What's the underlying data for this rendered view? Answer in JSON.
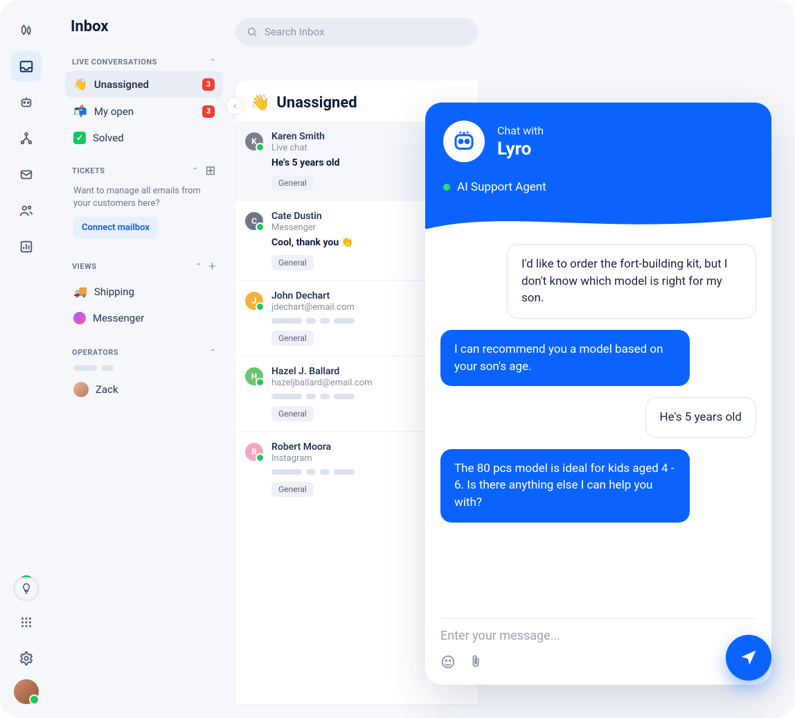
{
  "header": {
    "title": "Inbox",
    "search_placeholder": "Search Inbox"
  },
  "sections": {
    "live": {
      "title": "LIVE CONVERSATIONS",
      "items": [
        {
          "icon": "👋",
          "label": "Unassigned",
          "badge": "3"
        },
        {
          "icon": "📬",
          "label": "My open",
          "badge": "3"
        },
        {
          "icon": "✓",
          "label": "Solved"
        }
      ]
    },
    "tickets": {
      "title": "TICKETS",
      "note": "Want to manage all emails from your customers here?",
      "connect": "Connect mailbox"
    },
    "views": {
      "title": "VIEWS",
      "items": [
        {
          "icon": "🚚",
          "label": "Shipping"
        },
        {
          "icon": "💬",
          "label": "Messenger"
        }
      ]
    },
    "operators": {
      "title": "OPERATORS",
      "items": [
        {
          "label": "Zack"
        }
      ]
    }
  },
  "convlist": {
    "title": "Unassigned",
    "items": [
      {
        "initial": "K",
        "color": "#7a7f8d",
        "name": "Karen Smith",
        "source": "Live chat",
        "message": "He's 5 years old",
        "tag": "General"
      },
      {
        "initial": "C",
        "color": "#6e7686",
        "name": "Cate Dustin",
        "source": "Messenger",
        "message": "Cool, thank you 👏",
        "tag": "General"
      },
      {
        "initial": "J",
        "color": "#f2b23a",
        "name": "John Dechart",
        "source": "jdechart@email.com",
        "tag": "General"
      },
      {
        "initial": "H",
        "color": "#6cc56f",
        "name": "Hazel J. Ballard",
        "source": "hazeljballard@email.com",
        "tag": "General"
      },
      {
        "initial": "R",
        "color": "#f2a6c2",
        "name": "Robert Moora",
        "source": "Instagram",
        "tag": "General"
      }
    ]
  },
  "chat": {
    "chat_with": "Chat with",
    "name": "Lyro",
    "status": "AI Support Agent",
    "messages": [
      {
        "role": "user",
        "text": "I'd like to order the fort-building kit, but I don't know which model is right for my son."
      },
      {
        "role": "bot",
        "text": "I can recommend you a model based on your son's age."
      },
      {
        "role": "user",
        "text": "He's 5 years old"
      },
      {
        "role": "bot",
        "text": "The 80 pcs model is ideal for kids aged 4 - 6. Is there anything else I can help you with?"
      }
    ],
    "placeholder": "Enter your message..."
  }
}
